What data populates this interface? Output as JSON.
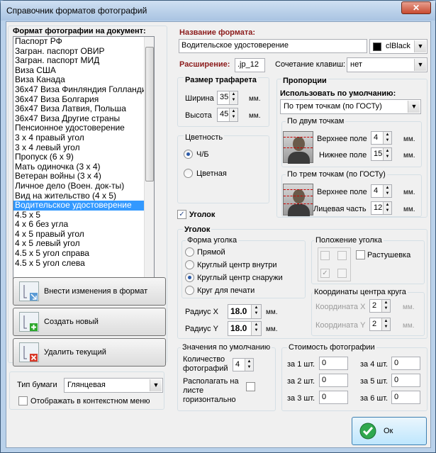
{
  "window": {
    "title": "Справочник форматов фотографий",
    "close_glyph": "✕"
  },
  "list": {
    "header": "Формат фотографии на документ:",
    "items": [
      "Паспорт РФ",
      "Загран. паспорт ОВИР",
      "Загран. паспорт МИД",
      "Виза США",
      "Виза Канада",
      "36x47 Виза Финляндия Голландия",
      "36x47 Виза Болгария",
      "36x47 Виза Латвия, Польша",
      "36x47 Виза Другие страны",
      "Пенсионное удостоверение",
      "3 x 4 правый угол",
      "3 x 4 левый угол",
      "Пропуск (6 x 9)",
      "Мать одиночка (3 x 4)",
      "Ветеран войны (3 x 4)",
      "Личное дело (Воен. док-ты)",
      "Вид на жительство (4 x 5)",
      "Водительское удостоверение",
      "4.5 x 5",
      "4 x 6 без угла",
      "4 x 5 правый угол",
      "4 x 5 левый угол",
      "4.5 x 5 угол справа",
      "4.5 x 5 угол слева"
    ],
    "selected_index": 17
  },
  "buttons": {
    "apply": "Внести изменения в формат",
    "create": "Создать новый",
    "delete": "Удалить текущий",
    "ok": "Ок"
  },
  "paper": {
    "label": "Тип бумаги",
    "value": "Глянцевая",
    "context_menu_label": "Отображать в контекстном меню"
  },
  "format": {
    "name_label": "Название формата:",
    "name_value": "Водительское удостоверение",
    "color_value": "clBlack",
    "color_hex": "#000000"
  },
  "ext": {
    "label": "Расширение:",
    "value": ".jp_12",
    "hotkey_label": "Сочетание клавиш:",
    "hotkey_value": "нет"
  },
  "stencil": {
    "title": "Размер трафарета",
    "width_label": "Ширина",
    "width_value": "35",
    "height_label": "Высота",
    "height_value": "45",
    "unit": "мм."
  },
  "color_mode": {
    "title": "Цветность",
    "bw": "Ч/Б",
    "color": "Цветная"
  },
  "proportions": {
    "title": "Пропорции",
    "default_label": "Использовать по умолчанию:",
    "default_value": "По трем точкам (по ГОСТу)",
    "two_title": "По двум точкам",
    "top_label": "Верхнее поле",
    "top_value": "4",
    "bottom_label": "Нижнее поле",
    "bottom_value": "15",
    "three_title": "По трем точкам (по ГОСТу)",
    "top3_label": "Верхнее поле",
    "top3_value": "4",
    "face_label": "Лицевая часть",
    "face_value": "12",
    "unit": "мм."
  },
  "corner": {
    "checkbox_label": "Уголок",
    "title": "Уголок",
    "shape_title": "Форма уголка",
    "shapes": [
      "Прямой",
      "Круглый центр внутри",
      "Круглый центр снаружи",
      "Круг для печати"
    ],
    "selected_shape": 2,
    "rx_label": "Радиус X",
    "rx_value": "18.0",
    "ry_label": "Радиус Y",
    "ry_value": "18.0",
    "unit": "мм.",
    "pos_title": "Положение уголка",
    "blur_label": "Растушевка",
    "center_title": "Координаты центра круга",
    "cx_label": "Координата X",
    "cx_value": "2",
    "cy_label": "Координата Y",
    "cy_value": "2"
  },
  "defaults": {
    "title": "Значения по умолчанию",
    "count_label1": "Количество",
    "count_label2": "фотографий",
    "count_value": "4",
    "horiz_label1": "Располагать на",
    "horiz_label2": "листе",
    "horiz_label3": "горизонтально"
  },
  "cost": {
    "title": "Стоимость фотографии",
    "items": [
      {
        "label": "за 1 шт.",
        "value": "0"
      },
      {
        "label": "за 2 шт.",
        "value": "0"
      },
      {
        "label": "за 3 шт.",
        "value": "0"
      },
      {
        "label": "за 4 шт.",
        "value": "0"
      },
      {
        "label": "за 5 шт.",
        "value": "0"
      },
      {
        "label": "за 6 шт.",
        "value": "0"
      }
    ]
  }
}
